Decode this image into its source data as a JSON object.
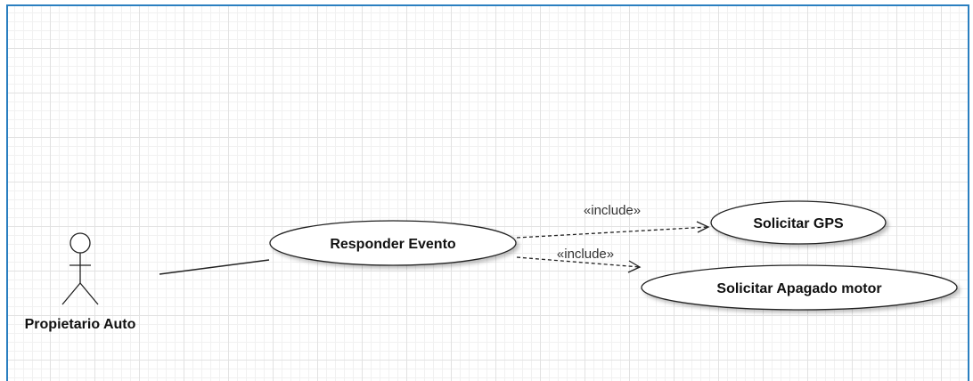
{
  "diagram": {
    "actor": {
      "name": "Propietario Auto"
    },
    "use_cases": {
      "responder": "Responder Evento",
      "gps": "Solicitar GPS",
      "apagado": "Solicitar Apagado motor"
    },
    "relations": {
      "include_gps": "«include»",
      "include_apagado": "«include»"
    },
    "colors": {
      "frame": "#2a7fc0",
      "line": "#222222",
      "grid": "#e2e2e2"
    }
  }
}
